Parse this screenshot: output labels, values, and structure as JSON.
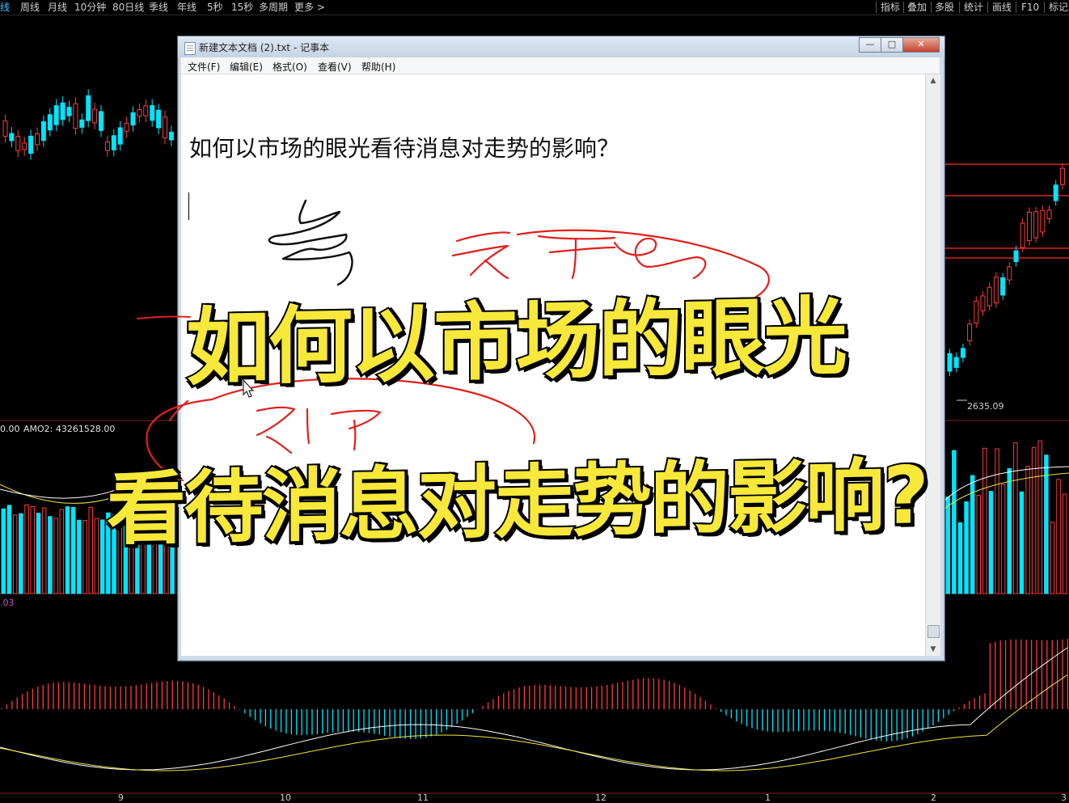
{
  "toolbar": {
    "left_items": [
      "线",
      "周线",
      "月线",
      "10分钟",
      "80日线",
      "季线",
      "年线",
      "5秒",
      "15秒",
      "多周期",
      "更多 >"
    ],
    "right_items": [
      "指标",
      "叠加",
      "多股",
      "统计",
      "画线",
      "F10",
      "标记"
    ]
  },
  "chart": {
    "price_low_label": "2635.09",
    "indicator_label_value": "0.00",
    "indicator_label_name": "AMO2: 43261528.00",
    "macd_label": ".03",
    "date_ticks": [
      "9",
      "10",
      "11",
      "12",
      "1",
      "2",
      "3"
    ],
    "colors": {
      "up": "#ff3c3c",
      "down": "#00e5ff",
      "line_white": "#ffffff",
      "line_yellow": "#f2e640",
      "level": "#e02020"
    }
  },
  "notepad": {
    "title": "新建文本文档 (2).txt - 记事本",
    "menu": [
      "文件(F)",
      "编辑(E)",
      "格式(O)",
      "查看(V)",
      "帮助(H)"
    ],
    "content": "如何以市场的眼光看待消息对走势的影响？",
    "buttons": [
      "minimize",
      "maximize",
      "close"
    ]
  },
  "caption": {
    "line1": "如何以市场的眼光",
    "line2": "看待消息对走势的影响?"
  }
}
